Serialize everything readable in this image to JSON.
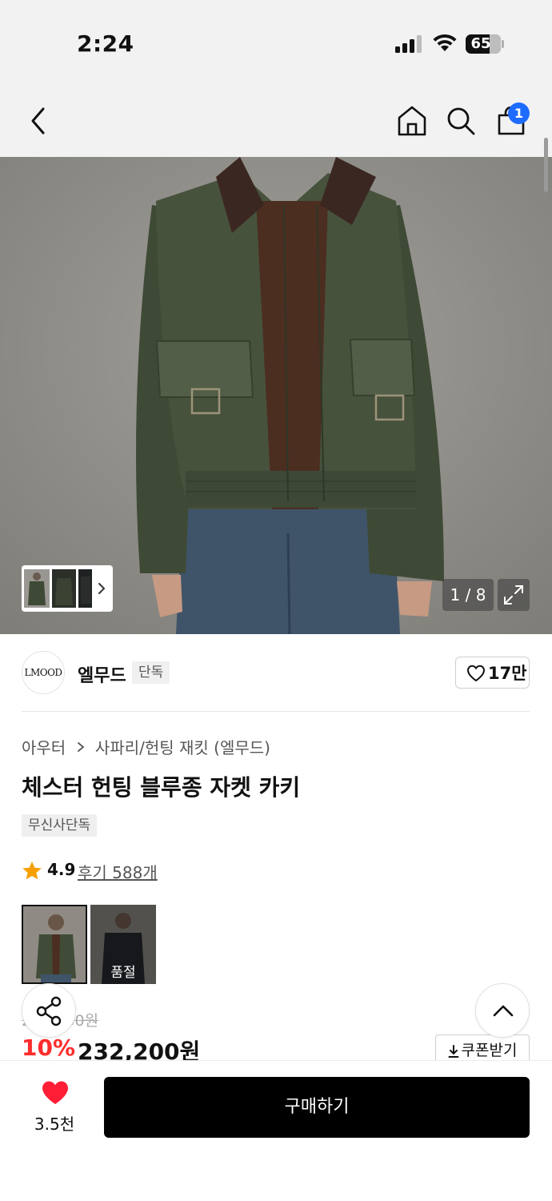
{
  "status_bar": {
    "time": "2:24",
    "battery": "65",
    "battery_level": 0.65,
    "icons": [
      "signal-icon",
      "wifi-icon",
      "battery-icon"
    ]
  },
  "nav": {
    "icons": [
      "back-icon",
      "home-icon",
      "search-icon",
      "cart-icon"
    ],
    "cart_count": "1",
    "badge_color": "#1e6cff"
  },
  "gallery": {
    "counter": "1 / 8",
    "icons": [
      "chevron-right-icon",
      "expand-icon"
    ]
  },
  "brand": {
    "logo_text": "LMOOD",
    "name": "엘무드",
    "tag": "단독",
    "like_count": "17만"
  },
  "product": {
    "breadcrumb": [
      "아우터",
      "사파리/헌팅 재킷 (엘무드)"
    ],
    "title": "체스터 헌팅 블루종 자켓 카키",
    "badge": "무신사단독",
    "rating": "4.9",
    "reviews": "후기 588개",
    "options": [
      {
        "status": ""
      },
      {
        "status": "품절"
      }
    ],
    "original_price": "258,000원",
    "discount": "10%",
    "price": "232,200원",
    "coupon_label": "쿠폰받기"
  },
  "bottom_bar": {
    "wish_count": "3.5천",
    "buy_label": "구매하기",
    "heart_color": "#ff1e36"
  },
  "colors": {
    "accent_red": "#ff2d2d",
    "primary_black": "#000000"
  }
}
